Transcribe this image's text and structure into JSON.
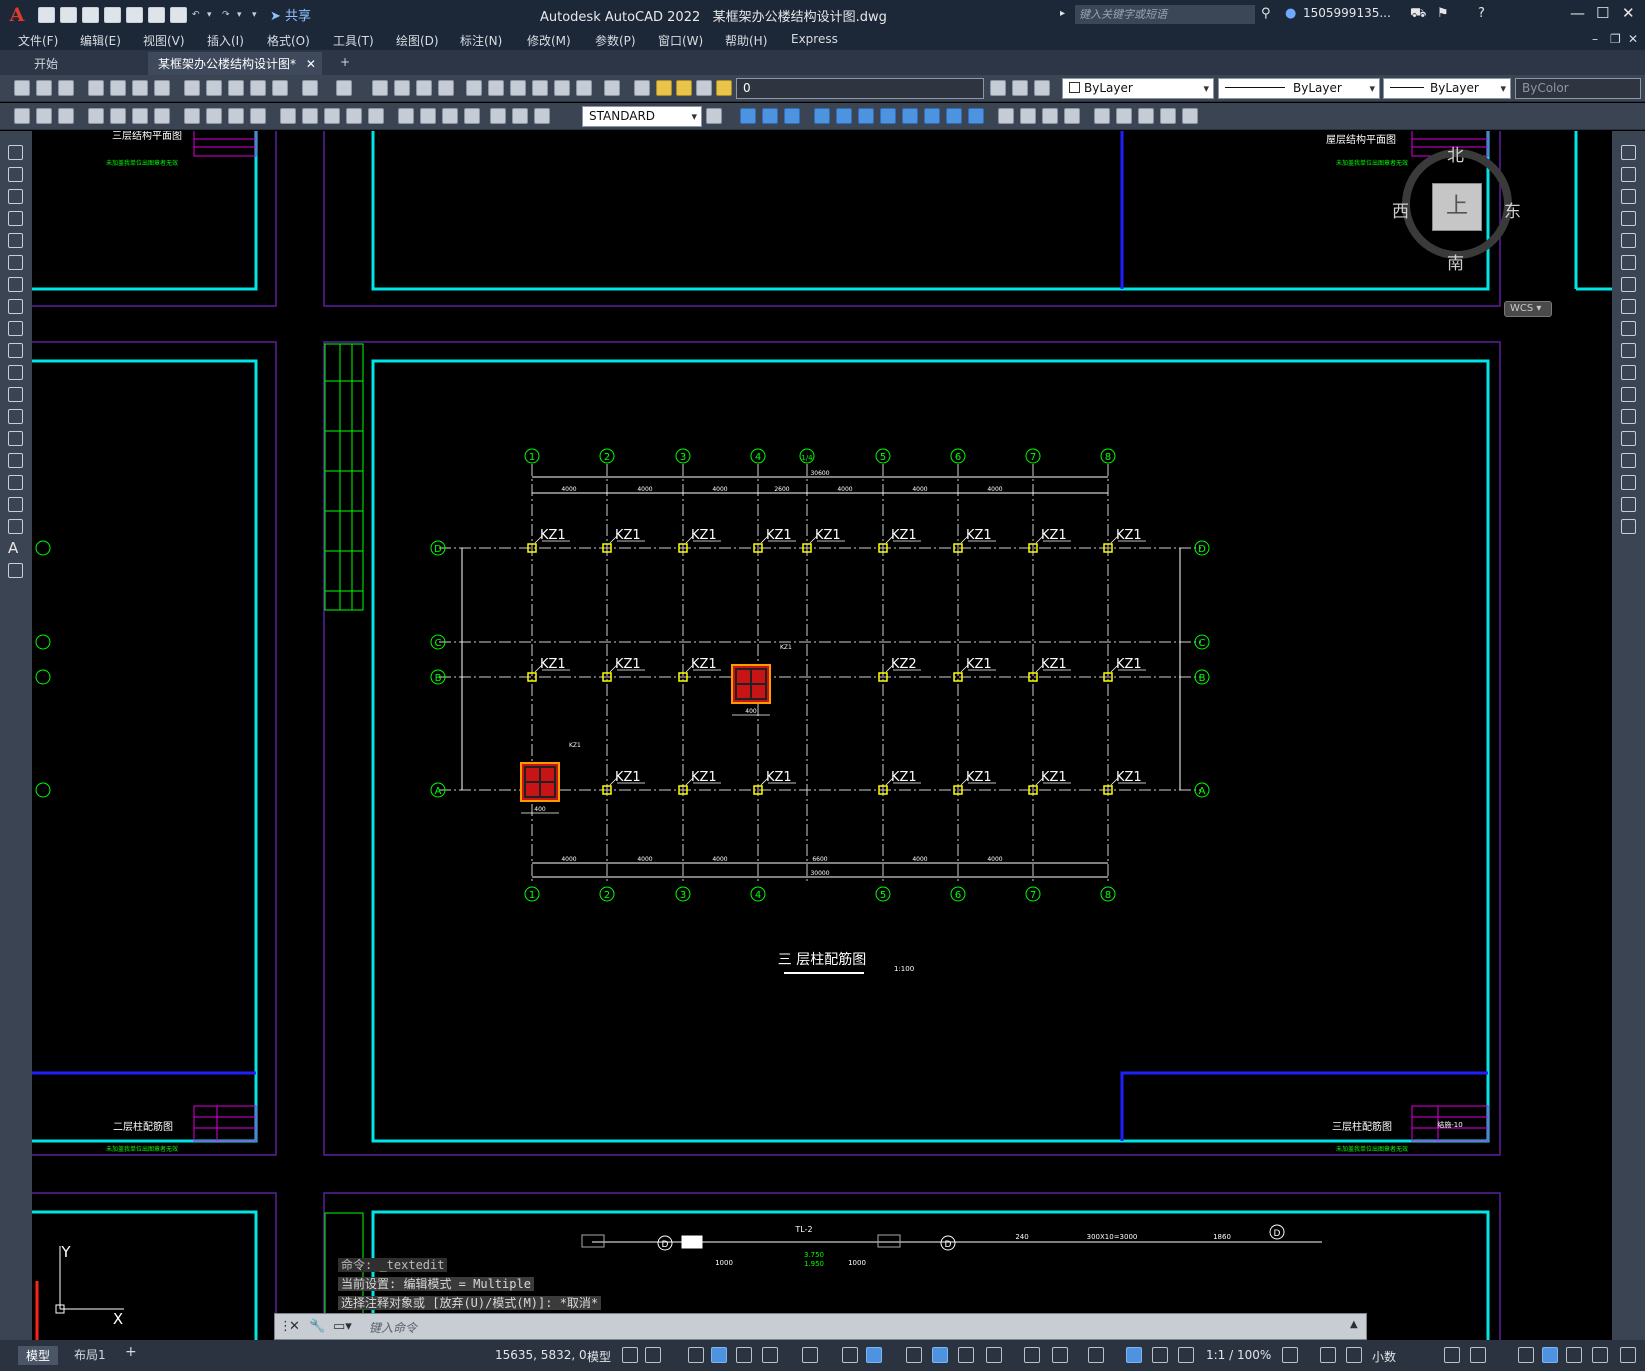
{
  "app": {
    "logo": "A",
    "title": "Autodesk AutoCAD 2022",
    "filename": "某框架办公楼结构设计图.dwg",
    "share": "共享",
    "search_placeholder": "键入关键字或短语",
    "user": "1505999135..."
  },
  "menu": [
    "文件(F)",
    "编辑(E)",
    "视图(V)",
    "插入(I)",
    "格式(O)",
    "工具(T)",
    "绘图(D)",
    "标注(N)",
    "修改(M)",
    "参数(P)",
    "窗口(W)",
    "帮助(H)",
    "Express"
  ],
  "tabs": [
    {
      "label": "开始"
    },
    {
      "label": "某框架办公楼结构设计图*"
    }
  ],
  "toolbar": {
    "layer": "0",
    "color": "ByLayer",
    "linetype": "ByLayer",
    "lineweight": "ByLayer",
    "plotstyle": "ByColor",
    "textstyle": "STANDARD"
  },
  "viewcube": {
    "north": "北",
    "south": "南",
    "east": "东",
    "west": "西",
    "top": "上",
    "wcs": "WCS"
  },
  "drawing": {
    "plan_title": "三 层柱配筋图",
    "scale": "1:100",
    "grid_top": [
      "1",
      "2",
      "3",
      "4",
      "1/4",
      "5",
      "6",
      "7",
      "8"
    ],
    "grid_bottom": [
      "1",
      "2",
      "3",
      "4",
      "5",
      "6",
      "7",
      "8"
    ],
    "grid_rows": [
      "D",
      "C",
      "B",
      "A"
    ],
    "total_dim": "30600",
    "total_dim_bottom": "30000",
    "spans_top": [
      "4000",
      "4000",
      "4000",
      "2600",
      "4000",
      "4000",
      "4000"
    ],
    "spans_bottom": [
      "4000",
      "4000",
      "4000",
      "6600",
      "4000",
      "4000"
    ],
    "sheet_left_top": "三层结构平面图",
    "sheet_right_top": "屋层结构平面图",
    "sheet_left": "二层柱配筋图",
    "sheet_right": "三层柱配筋图",
    "sheet_no": "结施-10",
    "footer_note": "未加盖我单位出图章者无效",
    "row_d_cols": [
      "KZ1",
      "KZ1",
      "KZ1",
      "KZ1",
      "KZ1",
      "KZ1",
      "KZ1",
      "KZ1",
      "KZ1"
    ],
    "row_b_cols": [
      "KZ1",
      "KZ1",
      "KZ1",
      "KZ2",
      "KZ1",
      "KZ1",
      "KZ1"
    ],
    "row_a_cols": [
      "KZ1",
      "KZ1",
      "KZ1",
      "KZ1",
      "KZ1",
      "KZ1",
      "KZ1"
    ],
    "detail_label": "KZ1",
    "detail_size": "400",
    "lower_label": "TL-2",
    "lower_dims": [
      "240",
      "300X10=3000",
      "1860"
    ],
    "lower_levels": [
      "3.750",
      "1.950"
    ],
    "lower_dim_1000": "1000"
  },
  "ucs": {
    "y": "Y",
    "x": "X"
  },
  "command": {
    "lines": [
      "命令: _textedit",
      "当前设置: 编辑模式 = Multiple",
      "选择注释对象或 [放弃(U)/模式(M)]: *取消*"
    ],
    "placeholder": "键入命令"
  },
  "status": {
    "model_tab": "模型",
    "layout_tab": "布局1",
    "add": "+",
    "coords": "15635, 5832, 0",
    "space": "模型",
    "scale": "1:1 / 100%",
    "units": "小数"
  }
}
